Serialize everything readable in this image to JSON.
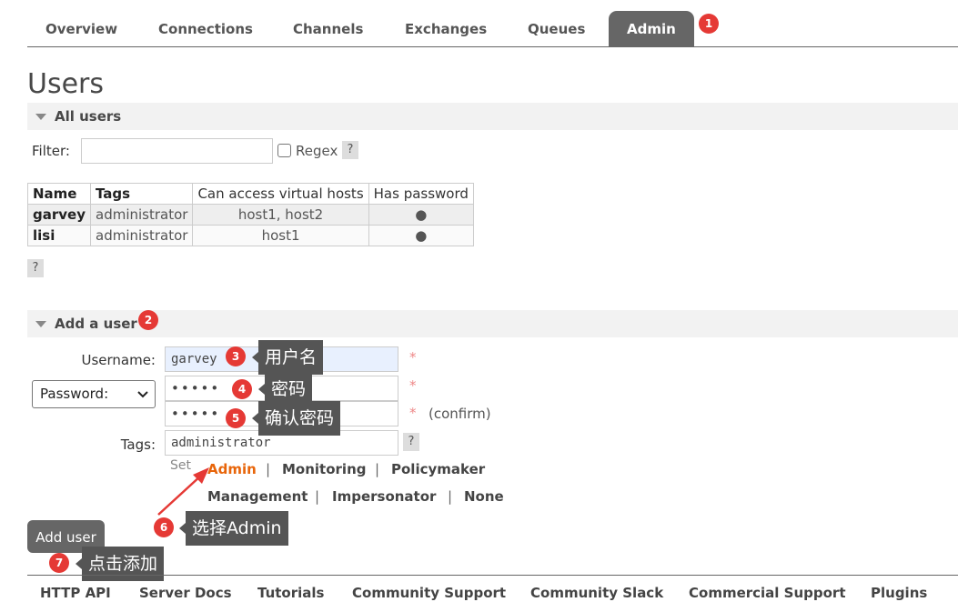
{
  "nav": {
    "tabs": [
      "Overview",
      "Connections",
      "Channels",
      "Exchanges",
      "Queues",
      "Admin"
    ],
    "active": "Admin"
  },
  "page_title": "Users",
  "all_users": {
    "heading": "All users",
    "filter_label": "Filter:",
    "filter_value": "",
    "regex_label": "Regex",
    "help": "?",
    "table": {
      "headers": [
        "Name",
        "Tags",
        "Can access virtual hosts",
        "Has password"
      ],
      "rows": [
        {
          "name": "garvey",
          "tags": "administrator",
          "vhosts": "host1, host2",
          "has_password": "●"
        },
        {
          "name": "lisi",
          "tags": "administrator",
          "vhosts": "host1",
          "has_password": "●"
        }
      ]
    }
  },
  "add_user": {
    "heading": "Add a user",
    "username_label": "Username:",
    "username_value": "garvey",
    "password_select": "Password:",
    "password_value": "•••••",
    "confirm_value": "•••••",
    "confirm_label": "(confirm)",
    "required_mark": "*",
    "tags_label": "Tags:",
    "tags_value": "administrator",
    "set_label": "Set",
    "tag_options": [
      "Admin",
      "Monitoring",
      "Policymaker",
      "Management",
      "Impersonator",
      "None"
    ],
    "separator": "|",
    "add_button": "Add user"
  },
  "annotations": {
    "badges": [
      "1",
      "2",
      "3",
      "4",
      "5",
      "6",
      "7"
    ],
    "callouts": [
      "用户名",
      "密码",
      "确认密码",
      "选择Admin",
      "点击添加"
    ],
    "badge_color": "#e53935"
  },
  "footer": {
    "links": [
      "HTTP API",
      "Server Docs",
      "Tutorials",
      "Community Support",
      "Community Slack",
      "Commercial Support",
      "Plugins"
    ]
  },
  "colors": {
    "active_tab": "#666666",
    "admin_tag": "#e8650a",
    "username_bg": "#e8f0fe"
  }
}
